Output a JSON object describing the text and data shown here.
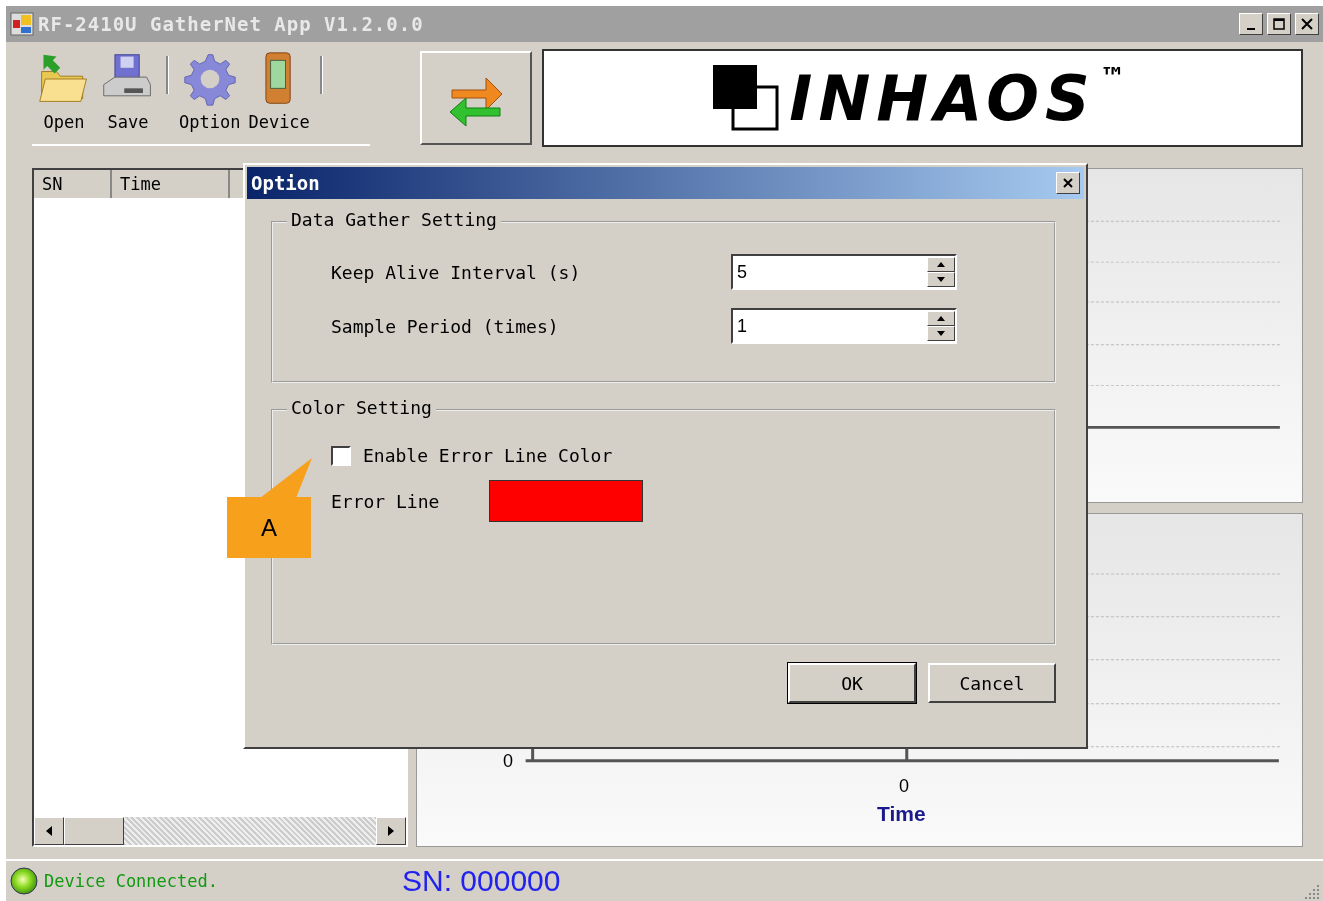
{
  "window": {
    "title": "RF-2410U GatherNet App V1.2.0.0"
  },
  "toolbar": [
    {
      "label": "Open",
      "kind": "open"
    },
    {
      "label": "Save",
      "kind": "save"
    },
    {
      "label": "Option",
      "kind": "option"
    },
    {
      "label": "Device",
      "kind": "device"
    }
  ],
  "logo": {
    "text": "INHAOS",
    "mark": "™"
  },
  "list": {
    "columns": [
      "SN",
      "Time"
    ]
  },
  "chart": {
    "y_tick": "0",
    "x_tick": "0",
    "xlabel": "Time"
  },
  "dialog": {
    "title": "Option",
    "gather": {
      "legend": "Data Gather Setting",
      "fields": [
        {
          "label": "Keep Alive Interval (s)",
          "value": "5"
        },
        {
          "label": "Sample Period (times)",
          "value": "1"
        }
      ]
    },
    "color": {
      "legend": "Color Setting",
      "checkbox": {
        "label": "Enable Error Line Color",
        "checked": false
      },
      "swatch": {
        "label": "Error Line",
        "color": "#ff0000"
      }
    },
    "buttons": [
      {
        "label": "OK",
        "default": true
      },
      {
        "label": "Cancel",
        "default": false
      }
    ]
  },
  "callout": {
    "label": "A"
  },
  "status_bar": {
    "message": "Device Connected.",
    "sn": "SN: 000000"
  }
}
